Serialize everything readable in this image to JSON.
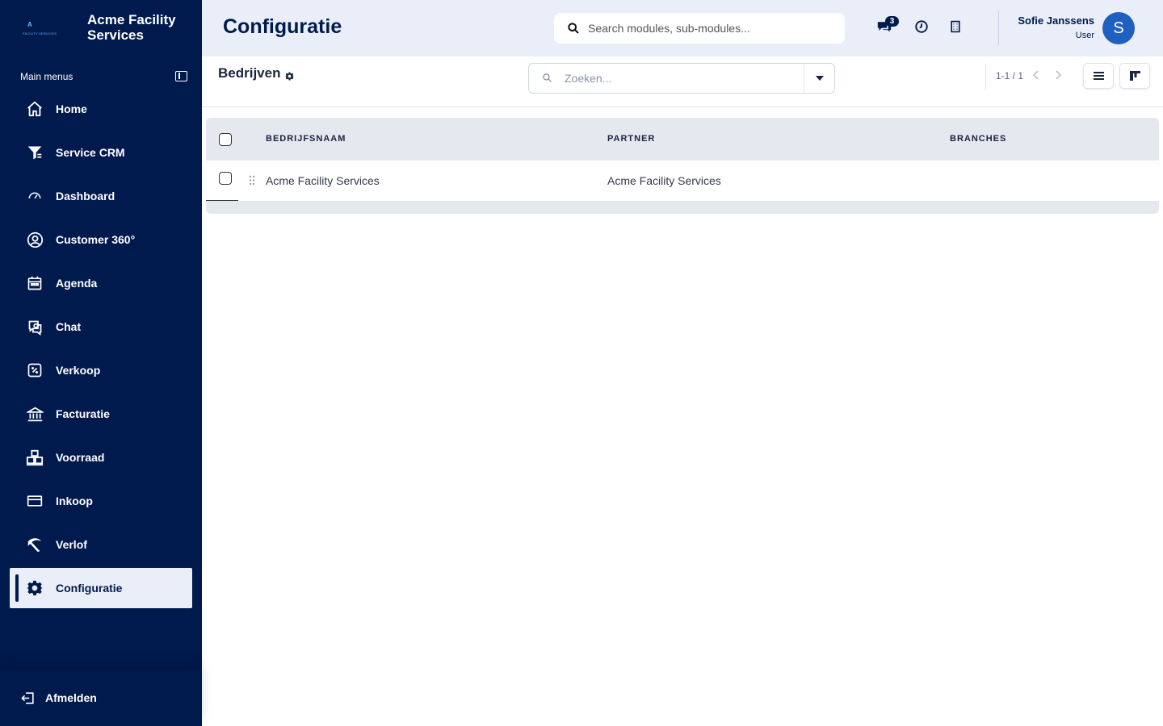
{
  "brand": {
    "name": "Acme Facility Services",
    "logo_letter": "A",
    "logo_subtext": "FACILITY SERVICES"
  },
  "sidebar": {
    "section_title": "Main menus",
    "items": [
      {
        "label": "Home",
        "icon": "home-icon"
      },
      {
        "label": "Service CRM",
        "icon": "filter-icon"
      },
      {
        "label": "Dashboard",
        "icon": "gauge-icon"
      },
      {
        "label": "Customer 360°",
        "icon": "user-circle-icon"
      },
      {
        "label": "Agenda",
        "icon": "calendar-icon"
      },
      {
        "label": "Chat",
        "icon": "chat-icon"
      },
      {
        "label": "Verkoop",
        "icon": "percent-icon"
      },
      {
        "label": "Facturatie",
        "icon": "bank-icon"
      },
      {
        "label": "Voorraad",
        "icon": "warehouse-icon"
      },
      {
        "label": "Inkoop",
        "icon": "card-icon"
      },
      {
        "label": "Verlof",
        "icon": "leave-icon"
      },
      {
        "label": "Configuratie",
        "icon": "gear-icon",
        "active": true
      }
    ],
    "logout_label": "Afmelden"
  },
  "header": {
    "title": "Configuratie",
    "search_placeholder": "Search modules, sub-modules...",
    "chat_badge": "3",
    "user_name": "Sofie Janssens",
    "user_role": "User",
    "avatar_initial": "S"
  },
  "toolbar": {
    "list_title": "Bedrijven",
    "filter_placeholder": "Zoeken...",
    "pager": "1-1 / 1"
  },
  "table": {
    "columns": [
      "BEDRIJFSNAAM",
      "PARTNER",
      "BRANCHES"
    ],
    "rows": [
      [
        "Acme Facility Services",
        "Acme Facility Services",
        ""
      ]
    ]
  },
  "colors": {
    "sidebar_bg": "#001a4d",
    "header_bg": "#e9eef9",
    "accent": "#1f5fbf"
  }
}
